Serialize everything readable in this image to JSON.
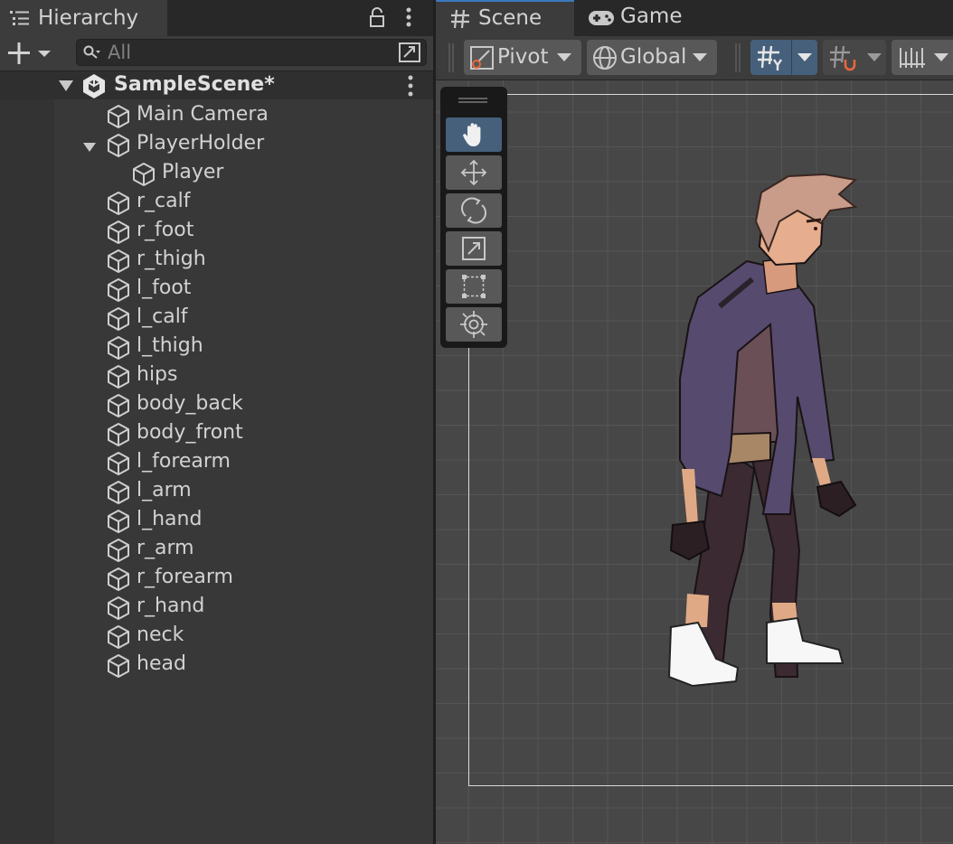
{
  "hierarchy": {
    "title": "Hierarchy",
    "search_placeholder": "All",
    "scene_name": "SampleScene*",
    "items": [
      {
        "label": "Main Camera",
        "depth": 1
      },
      {
        "label": "PlayerHolder",
        "depth": 1,
        "expanded": true
      },
      {
        "label": "Player",
        "depth": 2
      },
      {
        "label": "r_calf",
        "depth": 1
      },
      {
        "label": "r_foot",
        "depth": 1
      },
      {
        "label": "r_thigh",
        "depth": 1
      },
      {
        "label": "l_foot",
        "depth": 1
      },
      {
        "label": "l_calf",
        "depth": 1
      },
      {
        "label": "l_thigh",
        "depth": 1
      },
      {
        "label": "hips",
        "depth": 1
      },
      {
        "label": "body_back",
        "depth": 1
      },
      {
        "label": "body_front",
        "depth": 1
      },
      {
        "label": "l_forearm",
        "depth": 1
      },
      {
        "label": "l_arm",
        "depth": 1
      },
      {
        "label": "l_hand",
        "depth": 1
      },
      {
        "label": "r_arm",
        "depth": 1
      },
      {
        "label": "r_forearm",
        "depth": 1
      },
      {
        "label": "r_hand",
        "depth": 1
      },
      {
        "label": "neck",
        "depth": 1
      },
      {
        "label": "head",
        "depth": 1
      }
    ]
  },
  "scene": {
    "tabs": [
      {
        "label": "Scene",
        "icon": "grid-icon",
        "active": true
      },
      {
        "label": "Game",
        "icon": "gamepad-icon",
        "active": false
      }
    ],
    "toolbar": {
      "pivot_label": "Pivot",
      "global_label": "Global"
    },
    "tools": [
      "hand-tool",
      "move-tool",
      "rotate-tool",
      "scale-tool",
      "rect-tool",
      "transform-tool"
    ],
    "active_tool": "hand-tool"
  },
  "colors": {
    "panel": "#383838",
    "toolbar": "#3c3c3c",
    "accent": "#3a79bb",
    "selected_tool": "#46607c",
    "viewport": "#474747"
  }
}
